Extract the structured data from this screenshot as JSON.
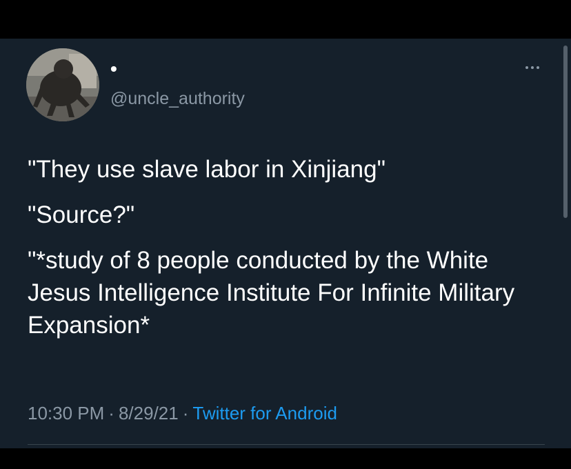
{
  "tweet": {
    "display_name": "•",
    "username": "@uncle_authority",
    "lines": [
      "\"They use slave labor in Xinjiang\"",
      "\"Source?\"",
      "\"*study of 8 people conducted by the White Jesus Intelligence Institute For Infinite Military Expansion*"
    ],
    "time": "10:30 PM",
    "date": "8/29/21",
    "source": "Twitter for Android",
    "separator": "·"
  },
  "icons": {
    "avatar": "statue-avatar",
    "more": "more-options-icon"
  },
  "colors": {
    "background": "#15202b",
    "text": "#ffffff",
    "secondary": "#8b98a5",
    "link": "#1d9bf0"
  }
}
